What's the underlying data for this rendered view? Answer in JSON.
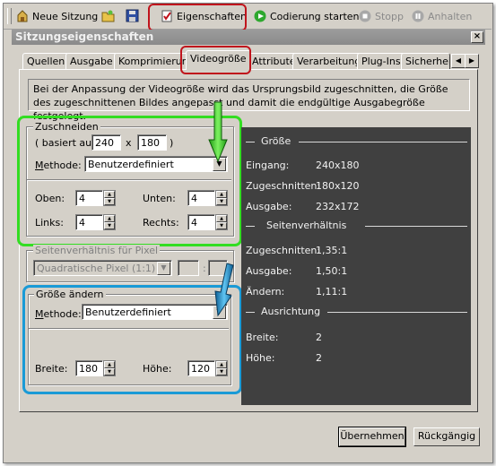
{
  "toolbar": {
    "new_session": "Neue Sitzung",
    "properties": "Eigenschaften",
    "start_encoding": "Codierung starten",
    "stop": "Stopp",
    "pause": "Anhalten"
  },
  "window": {
    "title": "Sitzungseigenschaften",
    "close": "×"
  },
  "tabs": [
    {
      "label": "Quellen"
    },
    {
      "label": "Ausgabe"
    },
    {
      "label": "Komprimierung"
    },
    {
      "label": "Videogröße",
      "active": true
    },
    {
      "label": "Attribute"
    },
    {
      "label": "Verarbeitung"
    },
    {
      "label": "Plug-Ins"
    },
    {
      "label": "Sicherheit"
    }
  ],
  "info_text": "Bei der Anpassung der Videogröße wird das Ursprungsbild zugeschnitten, die Größe des zugeschnittenen Bildes angepasst und damit die endgültige Ausgabegröße festgelegt.",
  "crop": {
    "title": "Zuschneiden",
    "based_on_prefix": "( basiert auf",
    "width": "240",
    "times": "x",
    "height": "180",
    "close_paren": ")",
    "method_label": "Methode:",
    "method_value": "Benutzerdefiniert",
    "top_label": "Oben:",
    "top_value": "4",
    "bottom_label": "Unten:",
    "bottom_value": "4",
    "left_label": "Links:",
    "left_value": "4",
    "right_label": "Rechts:",
    "right_value": "4"
  },
  "pixel_aspect": {
    "title": "Seitenverhältnis für Pixel",
    "value": "Quadratische Pixel (1:1)",
    "colon": ":"
  },
  "resize": {
    "title": "Größe ändern",
    "method_label": "Methode:",
    "method_value": "Benutzerdefiniert",
    "width_label": "Breite:",
    "width_value": "180",
    "height_label": "Höhe:",
    "height_value": "120"
  },
  "summary": {
    "size_header": "Größe",
    "input_label": "Eingang:",
    "input_value": "240x180",
    "cropped_label": "Zugeschnitten:",
    "cropped_value": "180x120",
    "output_label": "Ausgabe:",
    "output_value": "232x172",
    "aspect_header": "Seitenverhältnis",
    "aspect_cropped_label": "Zugeschnitten:",
    "aspect_cropped_value": "1,35:1",
    "aspect_output_label": "Ausgabe:",
    "aspect_output_value": "1,50:1",
    "aspect_change_label": "Ändern:",
    "aspect_change_value": "1,11:1",
    "orientation_header": "Ausrichtung",
    "width_label": "Breite:",
    "width_value": "2",
    "height_label": "Höhe:",
    "height_value": "2"
  },
  "buttons": {
    "apply": "Übernehmen",
    "revert": "Rückgängig"
  },
  "colors": {
    "highlight_red": "#c0141c",
    "highlight_green": "#33dd22",
    "highlight_blue": "#1a9ad6",
    "summary_bg": "#404040"
  }
}
